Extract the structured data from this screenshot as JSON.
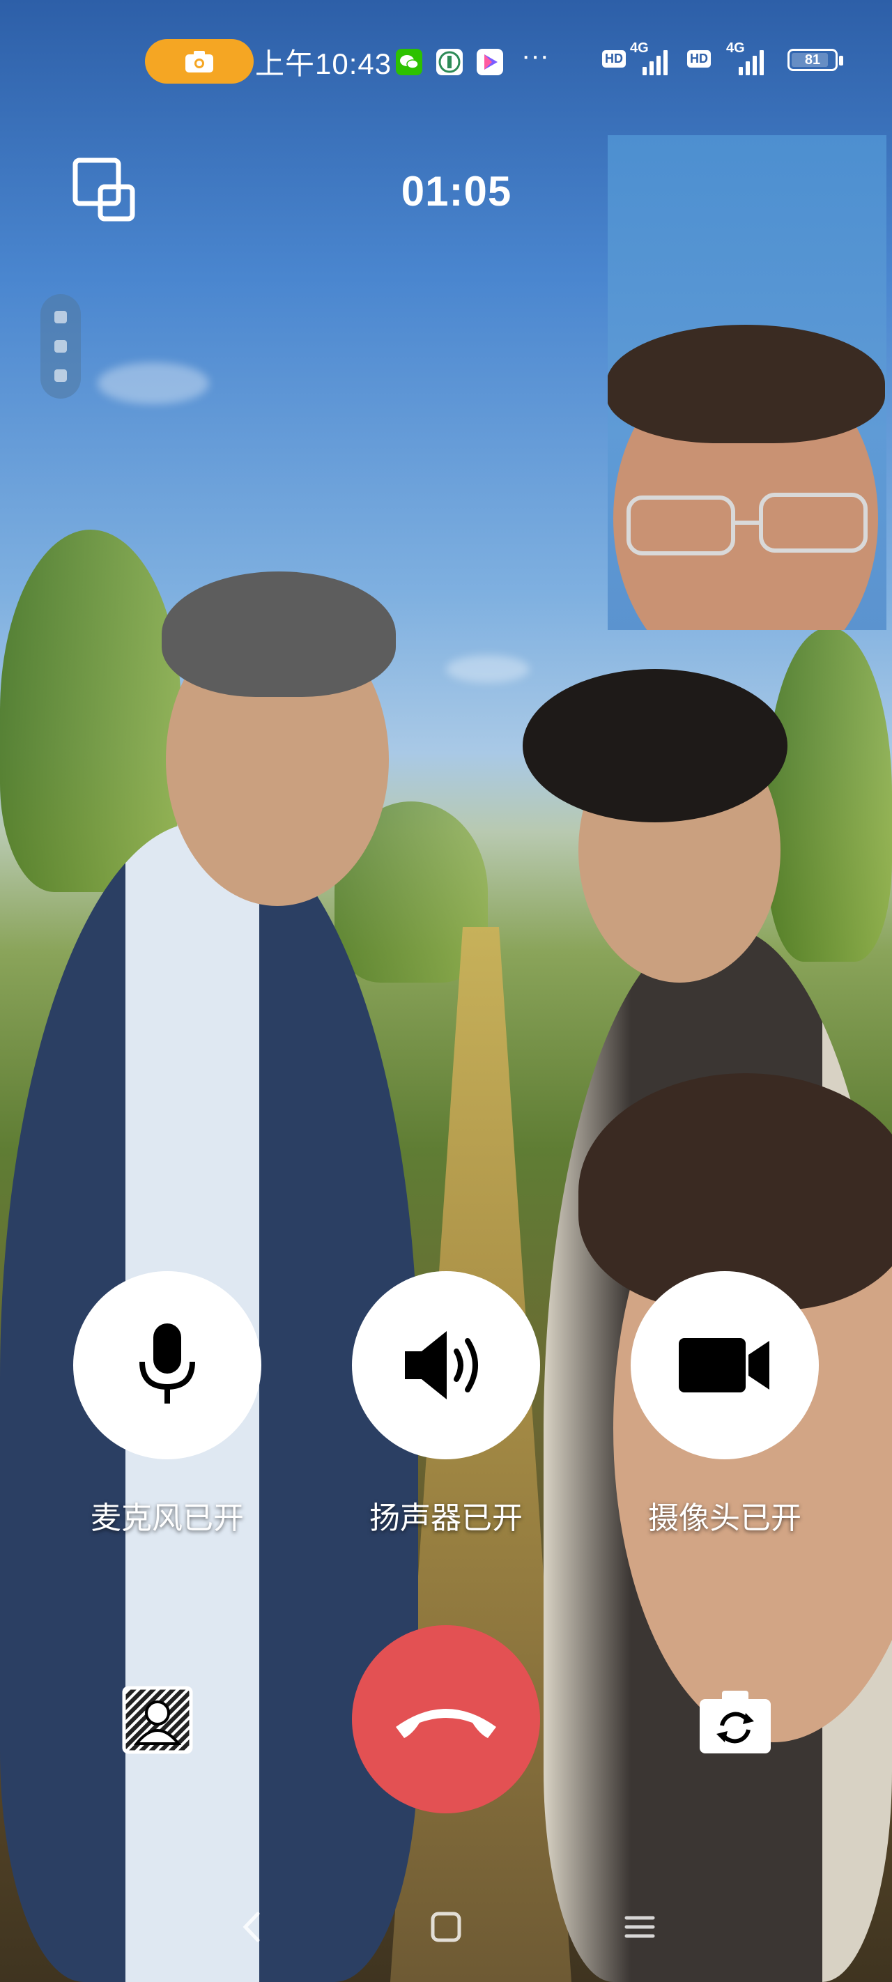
{
  "status_bar": {
    "time": "上午10:43",
    "camera_indicator_icon": "camera-icon",
    "notification_icons": [
      "wechat-icon",
      "app-icon",
      "play-store-icon"
    ],
    "more_indicator": "···",
    "sim1": {
      "hd": "HD",
      "network": "4G"
    },
    "sim2": {
      "hd": "HD",
      "network": "4G"
    },
    "battery": "81"
  },
  "call": {
    "duration": "01:05",
    "switch_window_icon": "window-switch-icon",
    "controls": [
      {
        "id": "microphone",
        "icon": "microphone-icon",
        "label": "麦克风已开"
      },
      {
        "id": "speaker",
        "icon": "speaker-icon",
        "label": "扬声器已开"
      },
      {
        "id": "camera",
        "icon": "video-camera-icon",
        "label": "摄像头已开"
      }
    ],
    "hangup_icon": "phone-hangup-icon",
    "background_icon": "portrait-background-icon",
    "flip_camera_icon": "flip-camera-icon"
  },
  "nav_bar": {
    "back_icon": "back-icon",
    "home_icon": "home-icon",
    "menu_icon": "menu-icon"
  },
  "colors": {
    "hangup": "#e35153",
    "camera_pill": "#f5a623",
    "button_bg": "#ffffff"
  }
}
